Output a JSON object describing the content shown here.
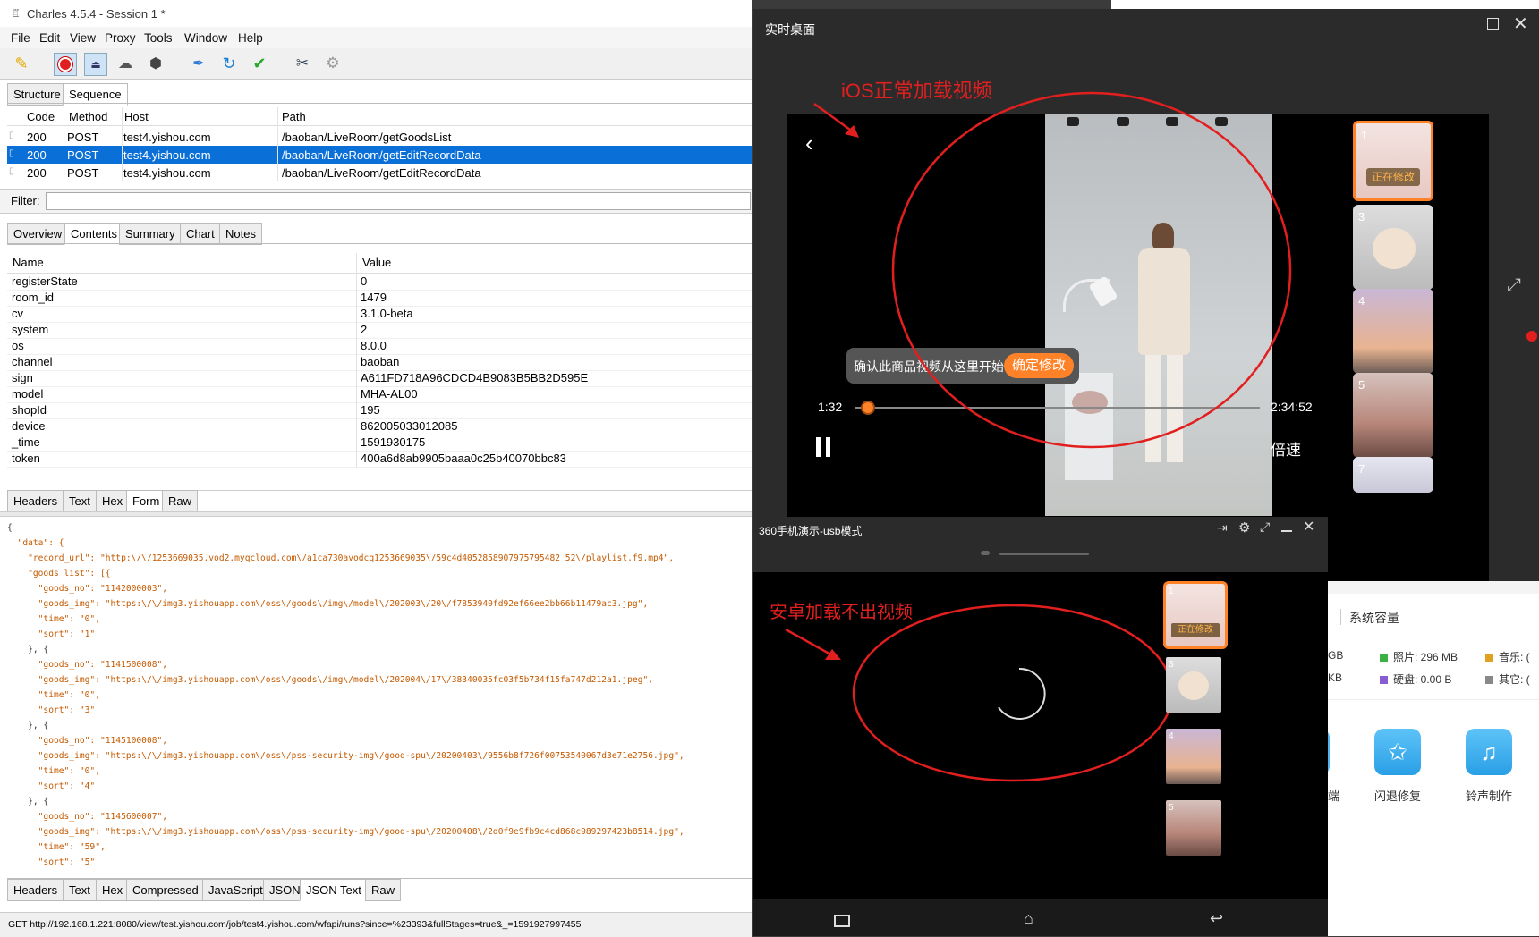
{
  "charles": {
    "title": "Charles 4.5.4 - Session 1 *",
    "menu": [
      "File",
      "Edit",
      "View",
      "Proxy",
      "Tools",
      "Window",
      "Help"
    ],
    "view_tabs": [
      "Structure",
      "Sequence"
    ],
    "columns": [
      "Code",
      "Method",
      "Host",
      "Path"
    ],
    "rows": [
      {
        "code": "200",
        "method": "POST",
        "host": "test4.yishou.com",
        "path": "/baoban/LiveRoom/getGoodsList"
      },
      {
        "code": "200",
        "method": "POST",
        "host": "test4.yishou.com",
        "path": "/baoban/LiveRoom/getEditRecordData"
      },
      {
        "code": "200",
        "method": "POST",
        "host": "test4.yishou.com",
        "path": "/baoban/LiveRoom/getEditRecordData"
      }
    ],
    "filter_label": "Filter:",
    "filter_value": "",
    "detail_tabs": [
      "Overview",
      "Contents",
      "Summary",
      "Chart",
      "Notes"
    ],
    "kv_headers": [
      "Name",
      "Value"
    ],
    "kv": [
      {
        "name": "registerState",
        "value": "0"
      },
      {
        "name": "room_id",
        "value": "1479"
      },
      {
        "name": "cv",
        "value": "3.1.0-beta"
      },
      {
        "name": "system",
        "value": "2"
      },
      {
        "name": "os",
        "value": "8.0.0"
      },
      {
        "name": "channel",
        "value": "baoban"
      },
      {
        "name": "sign",
        "value": "A611FD718A96CDCD4B9083B5BB2D595E"
      },
      {
        "name": "model",
        "value": "MHA-AL00"
      },
      {
        "name": "shopId",
        "value": "195"
      },
      {
        "name": "device",
        "value": "862005033012085"
      },
      {
        "name": "_time",
        "value": "1591930175"
      },
      {
        "name": "token",
        "value": "400a6d8ab9905baaa0c25b40070bbc83"
      }
    ],
    "request_tabs": [
      "Headers",
      "Text",
      "Hex",
      "Form",
      "Raw"
    ],
    "json_lines": [
      "{",
      "  \"data\": {",
      "    \"record_url\": \"http:\\/\\/1253669035.vod2.myqcloud.com\\/a1ca730avodcq1253669035\\/59c4d4052858907975795482 52\\/playlist.f9.mp4\",",
      "    \"goods_list\": [{",
      "      \"goods_no\": \"1142000003\",",
      "      \"goods_img\": \"https:\\/\\/img3.yishouapp.com\\/oss\\/goods\\/img\\/model\\/202003\\/20\\/f7853940fd92ef66ee2bb66b11479ac3.jpg\",",
      "      \"time\": \"0\",",
      "      \"sort\": \"1\"",
      "    }, {",
      "      \"goods_no\": \"1141500008\",",
      "      \"goods_img\": \"https:\\/\\/img3.yishouapp.com\\/oss\\/goods\\/img\\/model\\/202004\\/17\\/38340035fc03f5b734f15fa747d212a1.jpeg\",",
      "      \"time\": \"0\",",
      "      \"sort\": \"3\"",
      "    }, {",
      "      \"goods_no\": \"1145100008\",",
      "      \"goods_img\": \"https:\\/\\/img3.yishouapp.com\\/oss\\/pss-security-img\\/good-spu\\/20200403\\/9556b8f726f00753540067d3e71e2756.jpg\",",
      "      \"time\": \"0\",",
      "      \"sort\": \"4\"",
      "    }, {",
      "      \"goods_no\": \"1145600007\",",
      "      \"goods_img\": \"https:\\/\\/img3.yishouapp.com\\/oss\\/pss-security-img\\/good-spu\\/20200408\\/2d0f9e9fb9c4cd868c989297423b8514.jpg\",",
      "      \"time\": \"59\",",
      "      \"sort\": \"5\""
    ],
    "response_tabs": [
      "Headers",
      "Text",
      "Hex",
      "Compressed",
      "JavaScript",
      "JSON",
      "JSON Text",
      "Raw"
    ],
    "status": "GET http://192.168.1.221:8080/view/test.yishou.com/job/test4.yishou.com/wfapi/runs?since=%23393&fullStages=true&_=1591927997455"
  },
  "live": {
    "title": "实时桌面",
    "annotation": "iOS正常加载视频",
    "confirm_text": "确认此商品视频从这里开始",
    "confirm_button": "确定修改",
    "time_current": "1:32",
    "time_total": "2:34:52",
    "speed": "倍速",
    "progress": 0.026,
    "thumbs": [
      {
        "n": "1",
        "badge": "正在修改"
      },
      {
        "n": "3"
      },
      {
        "n": "4"
      },
      {
        "n": "5"
      },
      {
        "n": "7"
      }
    ]
  },
  "m360": {
    "title": "360手机演示-usb模式",
    "annotation": "安卓加载不出视频",
    "thumbs": [
      {
        "n": "1",
        "badge": "正在修改"
      },
      {
        "n": "3"
      },
      {
        "n": "4"
      },
      {
        "n": "5"
      }
    ]
  },
  "right_app": {
    "capacity_label": "系统容量",
    "legend": [
      {
        "label": "GB",
        "color": "#666"
      },
      {
        "label": "照片: 296 MB",
        "color": "#3cb043"
      },
      {
        "label": "音乐: (",
        "color": "#e0a020"
      },
      {
        "label": "KB",
        "color": "#666"
      },
      {
        "label": "硬盘: 0.00 B",
        "color": "#8a5cd1"
      },
      {
        "label": "其它: (",
        "color": "#888"
      }
    ],
    "tools": [
      "端",
      "闪退修复",
      "铃声制作"
    ]
  }
}
